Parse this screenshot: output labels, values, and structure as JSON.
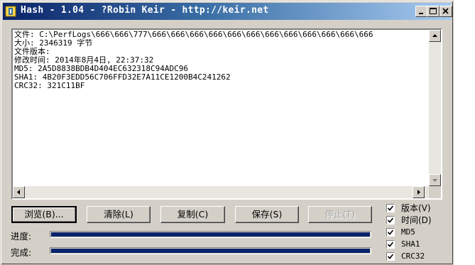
{
  "window": {
    "title": "Hash - 1.04 - ?Robin Keir - http://keir.net"
  },
  "output": {
    "lines": [
      "文件: C:\\PerfLogs\\666\\666\\777\\666\\666\\666\\666\\666\\666\\666\\666\\666\\666\\666\\666",
      "大小: 2346319 字节",
      "文件版本:",
      "修改时间: 2014年8月4日, 22:37:32",
      "MD5: 2A5D8838BDB4D404EC632318C94ADC96",
      "SHA1: 4B20F3EDD56C706FFD32E7A11CE1200B4C241262",
      "CRC32: 321C11BF"
    ]
  },
  "buttons": {
    "browse": "浏览(B)...",
    "clear": "清除(L)",
    "copy": "复制(C)",
    "save": "保存(S)",
    "stop": "停止(T)"
  },
  "progress": {
    "progress_label": "进度:",
    "complete_label": "完成:",
    "progress_value": 1.0,
    "complete_value": 1.0
  },
  "options": [
    {
      "label": "版本(V)",
      "checked": true
    },
    {
      "label": "时间(D)",
      "checked": true
    },
    {
      "label": "MD5",
      "checked": true
    },
    {
      "label": "SHA1",
      "checked": true
    },
    {
      "label": "CRC32",
      "checked": true
    }
  ],
  "colors": {
    "window_bg": "#d4d0c8",
    "title_bar_start": "#0a246a",
    "title_bar_end": "#a6caf0",
    "progress_fill": "#0a246a",
    "disabled_text": "#a0a0a0"
  },
  "icons": {
    "app": "app-icon",
    "minimize": "minimize-icon",
    "maximize": "maximize-icon",
    "close": "close-icon"
  }
}
